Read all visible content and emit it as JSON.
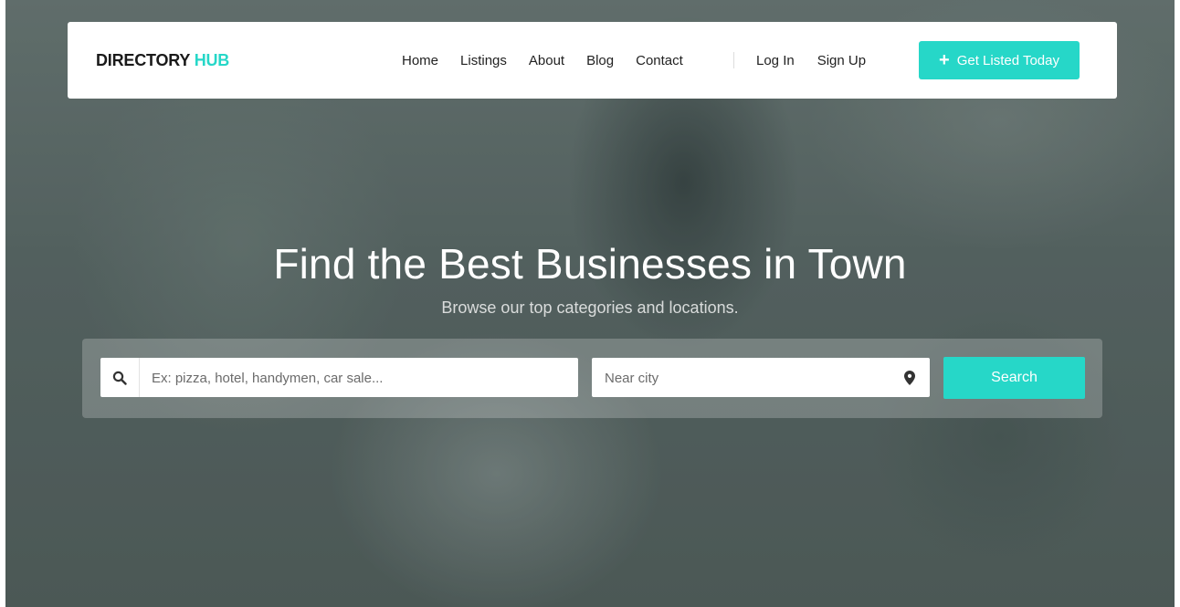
{
  "brand": {
    "name_part1": "DIRECTORY",
    "name_part2": "HUB",
    "accent_color": "#26d7c8"
  },
  "nav": {
    "links": [
      "Home",
      "Listings",
      "About",
      "Blog",
      "Contact"
    ],
    "login": "Log In",
    "signup": "Sign Up",
    "cta_label": "Get Listed Today",
    "cta_icon": "plus-icon"
  },
  "hero": {
    "title": "Find the Best Businesses in Town",
    "subtitle": "Browse our top categories and locations."
  },
  "search": {
    "keyword_placeholder": "Ex: pizza, hotel, handymen, car sale...",
    "keyword_value": "",
    "city_placeholder": "Near city",
    "city_value": "",
    "button_label": "Search",
    "keyword_icon": "search-icon",
    "city_icon": "map-pin-icon"
  }
}
